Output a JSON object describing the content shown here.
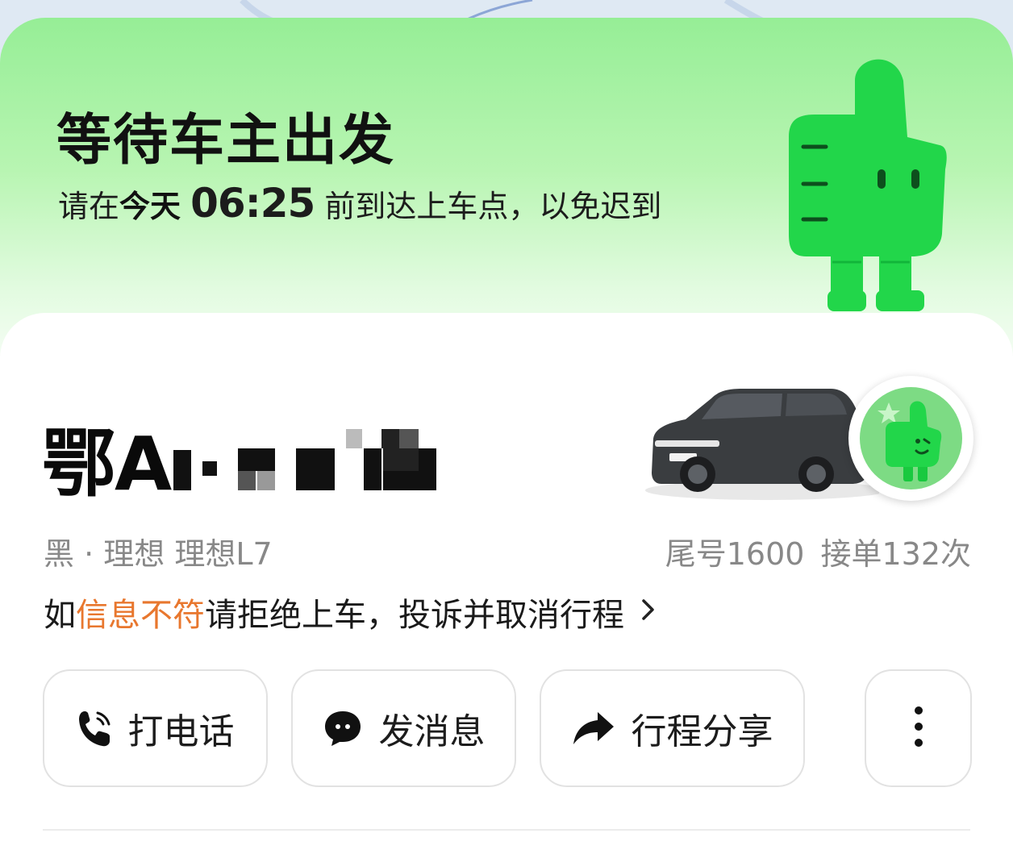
{
  "banner": {
    "title": "等待车主出发",
    "subtitle_prefix": "请在",
    "subtitle_day": "今天",
    "subtitle_time": "06:25",
    "subtitle_suffix": "前到达上车点，以免迟到"
  },
  "driver": {
    "plate_visible": "鄂A",
    "plate_separator": "·",
    "car_info": "黑 · 理想 理想L7",
    "tail_number": "尾号1600",
    "order_count": "接单132次"
  },
  "warning": {
    "prefix": "如",
    "highlight": "信息不符",
    "suffix": "请拒绝上车，投诉并取消行程",
    "chevron": "›"
  },
  "actions": {
    "call": {
      "label": "打电话",
      "icon": "phone-icon"
    },
    "message": {
      "label": "发消息",
      "icon": "chat-bubble-icon"
    },
    "share": {
      "label": "行程分享",
      "icon": "share-arrow-icon"
    },
    "more": {
      "icon": "more-vertical-icon"
    }
  },
  "colors": {
    "banner_green": "#96ee96",
    "mascot_green": "#22d64a",
    "highlight_orange": "#e8772e"
  }
}
